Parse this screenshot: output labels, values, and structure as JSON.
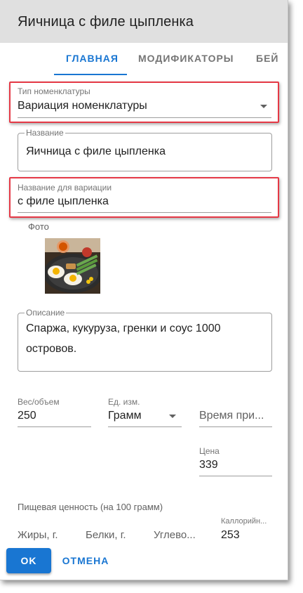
{
  "dialog": {
    "title": "Яичница с филе цыпленка"
  },
  "tabs": [
    {
      "label": "ГЛАВНАЯ",
      "active": true
    },
    {
      "label": "МОДИФИКАТОРЫ",
      "active": false
    },
    {
      "label": "БЕЙ",
      "active": false
    }
  ],
  "fields": {
    "nomenclature_type": {
      "label": "Тип номенклатуры",
      "value": "Вариация номенклатуры"
    },
    "name": {
      "label": "Название",
      "value": "Яичница с филе цыпленка"
    },
    "variation_name": {
      "label": "Название для вариации",
      "value": "с филе цыпленка"
    },
    "photo": {
      "label": "Фото"
    },
    "description": {
      "label": "Описание",
      "value_line1": "Спаржа, кукуруза, гренки и соус 1000",
      "value_line2": "островов."
    },
    "weight": {
      "label": "Вес/объем",
      "value": "250"
    },
    "unit": {
      "label": "Ед. изм.",
      "value": "Грамм"
    },
    "cook_time": {
      "placeholder": "Время при..."
    },
    "price": {
      "label": "Цена",
      "value": "339"
    }
  },
  "nutrition": {
    "section_label": "Пищевая ценность (на 100 грамм)",
    "fats": "Жиры, г.",
    "proteins": "Белки, г.",
    "carbs": "Углево...",
    "calories_label": "Каллорийн...",
    "calories_value": "253"
  },
  "actions": {
    "ok": "OK",
    "cancel": "ОТМЕНА"
  },
  "colors": {
    "accent": "#1976d2",
    "highlight": "#e53946",
    "header_bg": "#e0e0e0"
  }
}
